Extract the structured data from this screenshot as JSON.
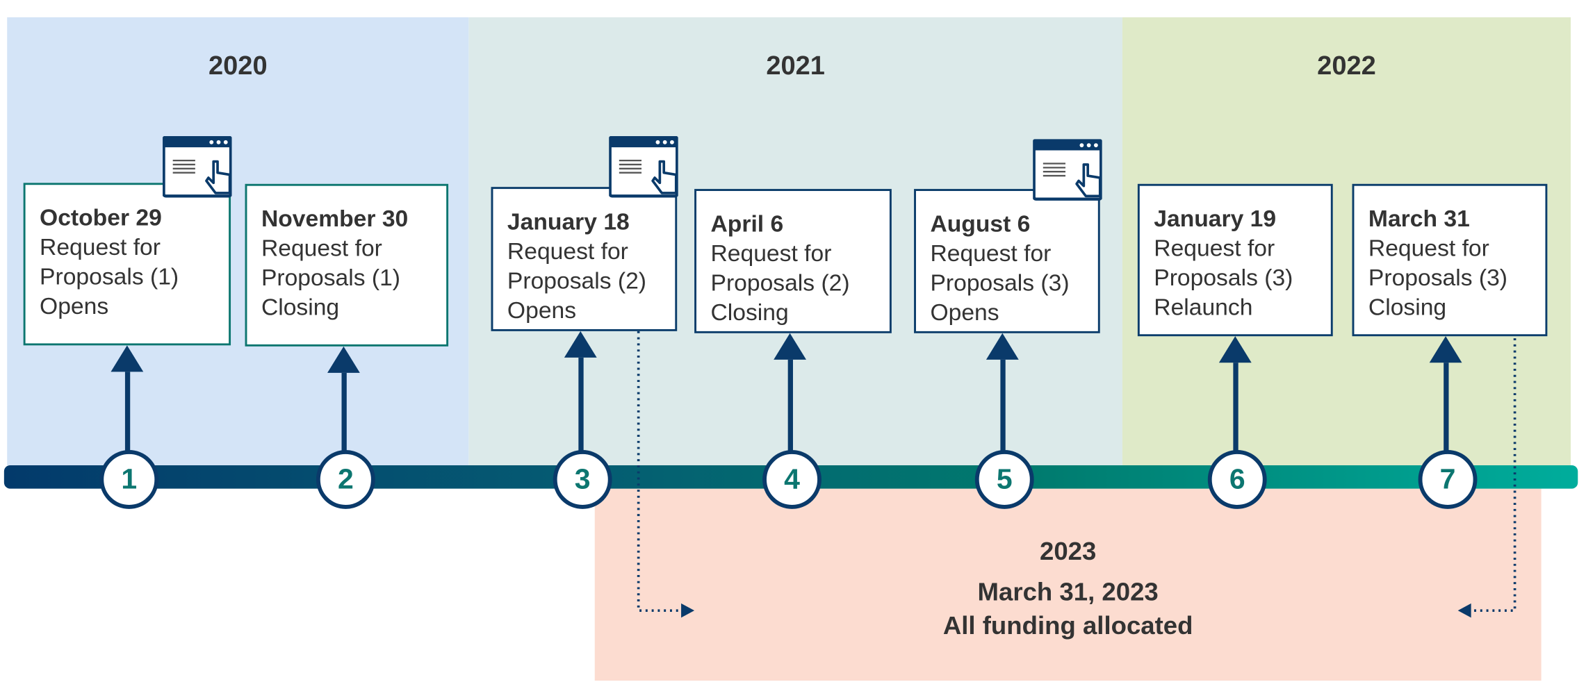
{
  "years": [
    "2020",
    "2021",
    "2022"
  ],
  "milestones": [
    {
      "number": "1",
      "date": "October 29",
      "lines": [
        "Request for",
        "Proposals (1)",
        "Opens"
      ],
      "border": "#0c7670",
      "icon": "browser-click-icon"
    },
    {
      "number": "2",
      "date": "November 30",
      "lines": [
        "Request for",
        "Proposals (1)",
        "Closing"
      ],
      "border": "#0c7670"
    },
    {
      "number": "3",
      "date": "January 18",
      "lines": [
        "Request for",
        "Proposals (2)",
        "Opens"
      ],
      "border": "#0b3d6b",
      "icon": "browser-click-icon"
    },
    {
      "number": "4",
      "date": "April 6",
      "lines": [
        "Request for",
        "Proposals (2)",
        "Closing"
      ],
      "border": "#0b3d6b"
    },
    {
      "number": "5",
      "date": "August 6",
      "lines": [
        "Request for",
        "Proposals (3)",
        "Opens"
      ],
      "border": "#0b3d6b",
      "icon": "browser-click-icon"
    },
    {
      "number": "6",
      "date": "January 19",
      "lines": [
        "Request for",
        "Proposals (3)",
        "Relaunch"
      ],
      "border": "#0b3d6b"
    },
    {
      "number": "7",
      "date": "March 31",
      "lines": [
        "Request for",
        "Proposals (3)",
        "Closing"
      ],
      "border": "#0b3d6b"
    }
  ],
  "final": {
    "year": "2023",
    "date": "March 31, 2023",
    "text": "All funding allocated"
  },
  "colors": {
    "band_2020": "#d4e4f7",
    "band_2021": "#dceaea",
    "band_2022": "#dfeac8",
    "final_box": "#fcdcd0",
    "navy": "#0a3a6a",
    "teal": "#0c7670"
  }
}
